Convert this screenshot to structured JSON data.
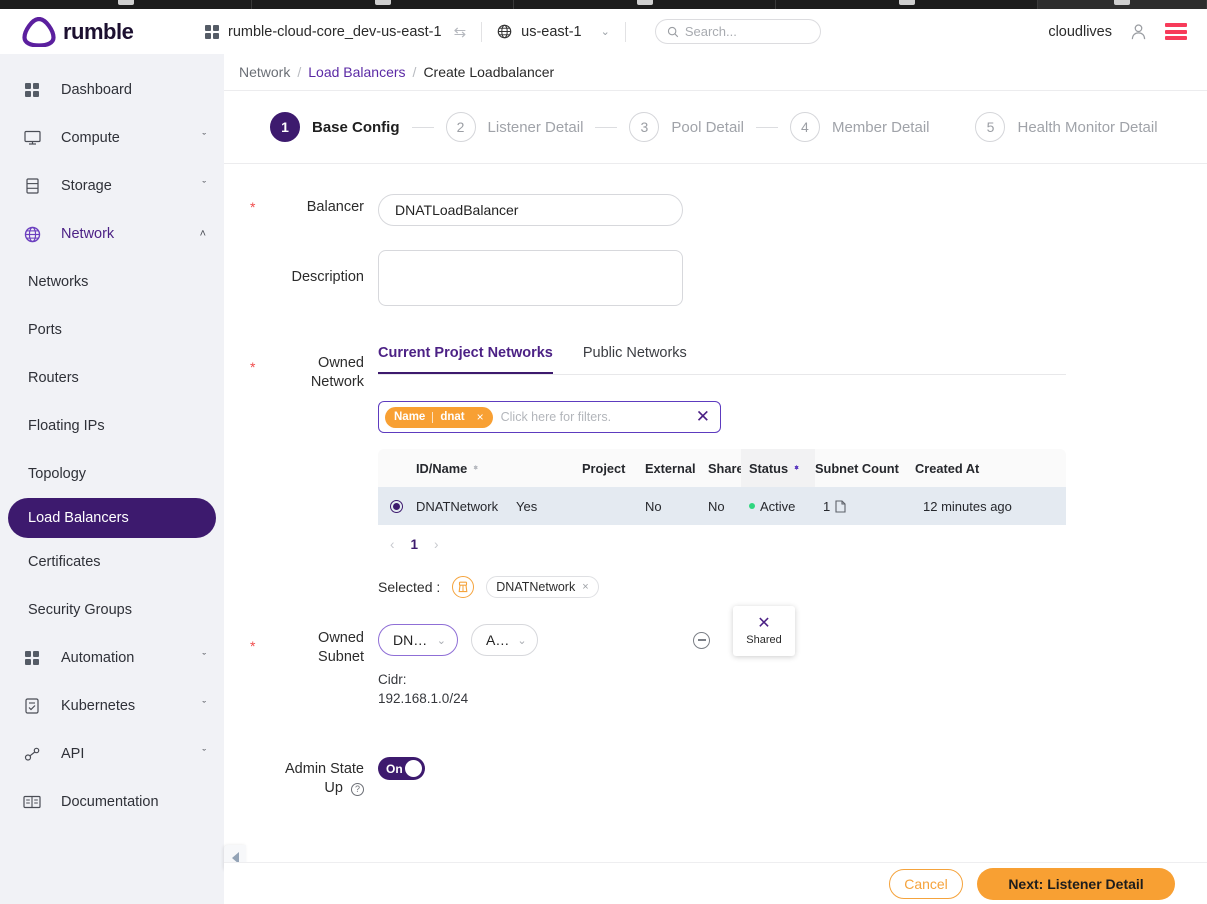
{
  "browser": {
    "tabs": 6
  },
  "topbar": {
    "brand": "rumble",
    "project": "rumble-cloud-core_dev-us-east-1",
    "region": "us-east-1",
    "search_placeholder": "Search...",
    "user": "cloudlives",
    "icons": {
      "grid": "grid-icon",
      "swap": "swap-icon",
      "globe": "globe-icon",
      "search": "search-icon",
      "avatar": "avatar-icon",
      "menu": "hamburger-menu-icon"
    },
    "accent_red": "#f73b5a"
  },
  "sidebar": {
    "items": [
      {
        "label": "Dashboard",
        "icon": "grid-icon",
        "type": "top",
        "caret": ""
      },
      {
        "label": "Compute",
        "icon": "monitor-icon",
        "type": "top",
        "caret": "ˇ"
      },
      {
        "label": "Storage",
        "icon": "database-icon",
        "type": "top",
        "caret": "ˇ"
      },
      {
        "label": "Network",
        "icon": "globe-icon",
        "type": "top",
        "caret": "ˆ",
        "active": true
      },
      {
        "label": "Networks",
        "type": "sub"
      },
      {
        "label": "Ports",
        "type": "sub"
      },
      {
        "label": "Routers",
        "type": "sub"
      },
      {
        "label": "Floating IPs",
        "type": "sub"
      },
      {
        "label": "Topology",
        "type": "sub"
      },
      {
        "label": "Load Balancers",
        "type": "sub",
        "selected": true
      },
      {
        "label": "Certificates",
        "type": "sub"
      },
      {
        "label": "Security Groups",
        "type": "sub"
      },
      {
        "label": "Automation",
        "icon": "grid-icon",
        "type": "top",
        "caret": "ˇ"
      },
      {
        "label": "Kubernetes",
        "icon": "k8s-icon",
        "type": "top",
        "caret": "ˇ"
      },
      {
        "label": "API",
        "icon": "api-icon",
        "type": "top",
        "caret": "ˇ"
      },
      {
        "label": "Documentation",
        "icon": "book-icon",
        "type": "top",
        "caret": ""
      }
    ]
  },
  "breadcrumb": {
    "root": "Network",
    "link": "Load Balancers",
    "current": "Create Loadbalancer",
    "sep": "/"
  },
  "steps": [
    {
      "n": "1",
      "label": "Base Config",
      "current": true
    },
    {
      "n": "2",
      "label": "Listener Detail",
      "current": false
    },
    {
      "n": "3",
      "label": "Pool Detail",
      "current": false
    },
    {
      "n": "4",
      "label": "Member Detail",
      "current": false
    },
    {
      "n": "5",
      "label": "Health Monitor Detail",
      "current": false
    }
  ],
  "form": {
    "balancer_label": "Balancer",
    "balancer_value": "DNATLoadBalancer",
    "description_label": "Description",
    "description_value": "",
    "owned_network_label_1": "Owned",
    "owned_network_label_2": "Network",
    "owned_subnet_label_1": "Owned",
    "owned_subnet_label_2": "Subnet",
    "admin_state_label_1": "Admin State",
    "admin_state_label_2": "Up",
    "required_mark": "*"
  },
  "network_tabs": [
    {
      "label": "Current Project Networks",
      "active": true
    },
    {
      "label": "Public Networks",
      "active": false
    }
  ],
  "filter": {
    "chip_key": "Name",
    "chip_value": "dnat",
    "chip_close": "×",
    "placeholder": "Click here for filters.",
    "clear_all": "✕"
  },
  "popover": {
    "close": "✕",
    "label": "Shared"
  },
  "table": {
    "columns": [
      {
        "key": "radio",
        "label": ""
      },
      {
        "key": "idname",
        "label": "ID/Name",
        "sortable": true
      },
      {
        "key": "hidden",
        "label": ""
      },
      {
        "key": "project",
        "label": "Project"
      },
      {
        "key": "external",
        "label": "External"
      },
      {
        "key": "shared",
        "label": "Shared"
      },
      {
        "key": "status",
        "label": "Status",
        "sortable": true,
        "sorted": true
      },
      {
        "key": "subnet_count",
        "label": "Subnet Count"
      },
      {
        "key": "created_at",
        "label": "Created At"
      }
    ],
    "rows": [
      {
        "selected": true,
        "idname": "DNATNetwork",
        "col2": "Yes",
        "project": "",
        "external": "No",
        "shared": "No",
        "status": "Active",
        "status_color": "#2fd67f",
        "subnet_count": "1",
        "created_at": "12 minutes ago"
      }
    ]
  },
  "pagination": {
    "prev": "‹",
    "page": "1",
    "next": "›"
  },
  "selected": {
    "label": "Selected :",
    "clear_icon": "clear-filter-icon",
    "chips": [
      {
        "label": "DNATNetwork",
        "close": "×"
      }
    ]
  },
  "subnet": {
    "network_select": "DN…",
    "ip_select": "A…",
    "remove_icon": "minus-circle-icon",
    "cidr_label": "Cidr:",
    "cidr_value": "192.168.1.0/24"
  },
  "admin_state": {
    "on_label": "On",
    "help": "?"
  },
  "footer": {
    "cancel": "Cancel",
    "next": "Next: Listener Detail"
  },
  "colors": {
    "purple": "#3d1a6e",
    "link_purple": "#5b2aa5",
    "orange": "#f8a033",
    "row_blue": "#e4eaf1"
  }
}
